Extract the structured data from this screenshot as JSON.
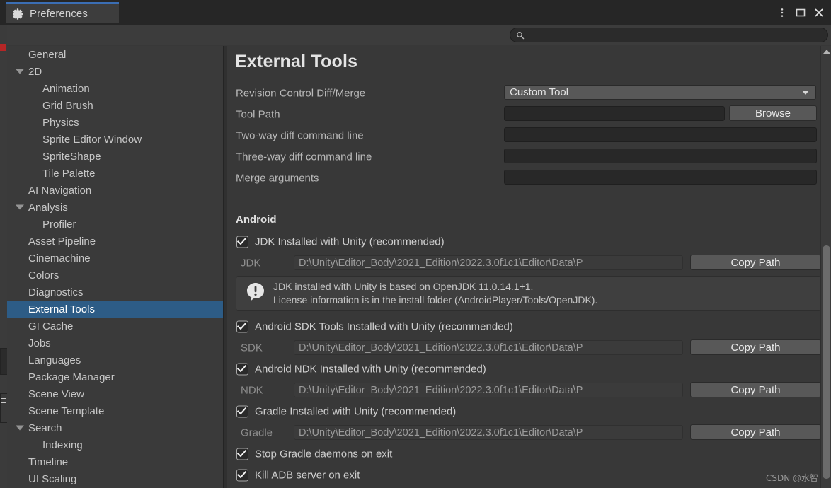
{
  "window": {
    "tab_label": "Preferences",
    "gear_icon": "gear-icon",
    "controls": {
      "menu": "⋮",
      "maximize": "▢",
      "close": "✕"
    }
  },
  "search": {
    "value": "",
    "placeholder": "",
    "icon": "search-icon"
  },
  "sidebar": {
    "items": [
      {
        "label": "General",
        "depth": 0,
        "arrow": false,
        "selected": false
      },
      {
        "label": "2D",
        "depth": 0,
        "arrow": true,
        "selected": false
      },
      {
        "label": "Animation",
        "depth": 1,
        "arrow": false,
        "selected": false
      },
      {
        "label": "Grid Brush",
        "depth": 1,
        "arrow": false,
        "selected": false
      },
      {
        "label": "Physics",
        "depth": 1,
        "arrow": false,
        "selected": false
      },
      {
        "label": "Sprite Editor Window",
        "depth": 1,
        "arrow": false,
        "selected": false
      },
      {
        "label": "SpriteShape",
        "depth": 1,
        "arrow": false,
        "selected": false
      },
      {
        "label": "Tile Palette",
        "depth": 1,
        "arrow": false,
        "selected": false
      },
      {
        "label": "AI Navigation",
        "depth": 0,
        "arrow": false,
        "selected": false
      },
      {
        "label": "Analysis",
        "depth": 0,
        "arrow": true,
        "selected": false
      },
      {
        "label": "Profiler",
        "depth": 1,
        "arrow": false,
        "selected": false
      },
      {
        "label": "Asset Pipeline",
        "depth": 0,
        "arrow": false,
        "selected": false
      },
      {
        "label": "Cinemachine",
        "depth": 0,
        "arrow": false,
        "selected": false
      },
      {
        "label": "Colors",
        "depth": 0,
        "arrow": false,
        "selected": false
      },
      {
        "label": "Diagnostics",
        "depth": 0,
        "arrow": false,
        "selected": false
      },
      {
        "label": "External Tools",
        "depth": 0,
        "arrow": false,
        "selected": true
      },
      {
        "label": "GI Cache",
        "depth": 0,
        "arrow": false,
        "selected": false
      },
      {
        "label": "Jobs",
        "depth": 0,
        "arrow": false,
        "selected": false
      },
      {
        "label": "Languages",
        "depth": 0,
        "arrow": false,
        "selected": false
      },
      {
        "label": "Package Manager",
        "depth": 0,
        "arrow": false,
        "selected": false
      },
      {
        "label": "Scene View",
        "depth": 0,
        "arrow": false,
        "selected": false
      },
      {
        "label": "Scene Template",
        "depth": 0,
        "arrow": false,
        "selected": false
      },
      {
        "label": "Search",
        "depth": 0,
        "arrow": true,
        "selected": false
      },
      {
        "label": "Indexing",
        "depth": 1,
        "arrow": false,
        "selected": false
      },
      {
        "label": "Timeline",
        "depth": 0,
        "arrow": false,
        "selected": false
      },
      {
        "label": "UI Scaling",
        "depth": 0,
        "arrow": false,
        "selected": false
      }
    ]
  },
  "main": {
    "title": "External Tools",
    "revision_control": {
      "label": "Revision Control Diff/Merge",
      "value": "Custom Tool"
    },
    "tool_path": {
      "label": "Tool Path",
      "value": "",
      "browse_label": "Browse"
    },
    "two_way": {
      "label": "Two-way diff command line",
      "value": ""
    },
    "three_way": {
      "label": "Three-way diff command line",
      "value": ""
    },
    "merge_args": {
      "label": "Merge arguments",
      "value": ""
    },
    "android": {
      "heading": "Android",
      "jdk_checkbox": {
        "label": "JDK Installed with Unity (recommended)",
        "checked": true
      },
      "jdk_path": {
        "label": "JDK",
        "value": "D:\\Unity\\Editor_Body\\2021_Edition\\2022.3.0f1c1\\Editor\\Data\\P",
        "copy_label": "Copy Path"
      },
      "info": {
        "icon": "info-exclamation-icon",
        "line1": "JDK installed with Unity is based on OpenJDK 11.0.14.1+1.",
        "line2": "License information is in the install folder (AndroidPlayer/Tools/OpenJDK)."
      },
      "sdk_checkbox": {
        "label": "Android SDK Tools Installed with Unity (recommended)",
        "checked": true
      },
      "sdk_path": {
        "label": "SDK",
        "value": "D:\\Unity\\Editor_Body\\2021_Edition\\2022.3.0f1c1\\Editor\\Data\\P",
        "copy_label": "Copy Path"
      },
      "ndk_checkbox": {
        "label": "Android NDK Installed with Unity (recommended)",
        "checked": true
      },
      "ndk_path": {
        "label": "NDK",
        "value": "D:\\Unity\\Editor_Body\\2021_Edition\\2022.3.0f1c1\\Editor\\Data\\P",
        "copy_label": "Copy Path"
      },
      "gradle_checkbox": {
        "label": "Gradle Installed with Unity (recommended)",
        "checked": true
      },
      "gradle_path": {
        "label": "Gradle",
        "value": "D:\\Unity\\Editor_Body\\2021_Edition\\2022.3.0f1c1\\Editor\\Data\\P",
        "copy_label": "Copy Path"
      },
      "stop_gradle": {
        "label": "Stop Gradle daemons on exit",
        "checked": true
      },
      "kill_adb": {
        "label": "Kill ADB server on exit",
        "checked": true
      }
    }
  },
  "watermark": "CSDN @水智",
  "colors": {
    "accent_selection": "#2d5c86",
    "tab_accent": "#3b6eb4",
    "window_bg": "#383838",
    "titlebar_bg": "#262626",
    "field_bg": "#282828",
    "button_bg": "#585858"
  }
}
